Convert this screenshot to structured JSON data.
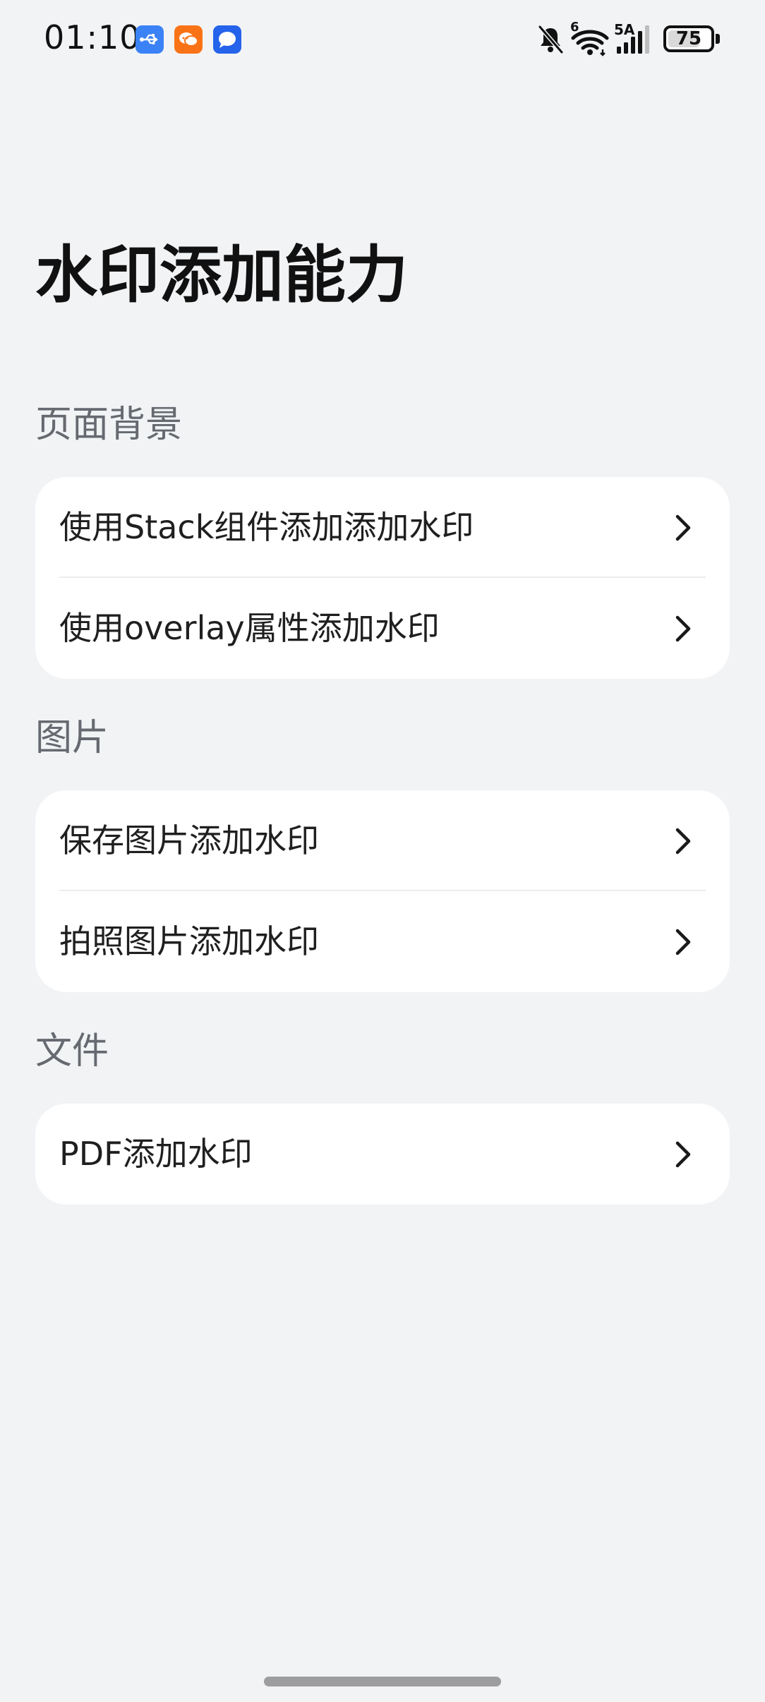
{
  "status_bar": {
    "time": "01:10",
    "notification_icons": [
      "usb-icon",
      "chat-bubble-icon",
      "message-icon"
    ],
    "notification_colors": [
      "#3b82f6",
      "#f97316",
      "#2563eb"
    ],
    "right_icons": [
      "bell-muted-icon",
      "wifi-icon",
      "signal-icon"
    ],
    "wifi_badge": "6",
    "signal_label": "5A",
    "battery_level": "75",
    "battery_percent": 75
  },
  "page": {
    "title": "水印添加能力"
  },
  "sections": [
    {
      "title": "页面背景",
      "items": [
        {
          "label": "使用Stack组件添加添加水印"
        },
        {
          "label": "使用overlay属性添加水印"
        }
      ]
    },
    {
      "title": "图片",
      "items": [
        {
          "label": "保存图片添加水印"
        },
        {
          "label": "拍照图片添加水印"
        }
      ]
    },
    {
      "title": "文件",
      "items": [
        {
          "label": "PDF添加水印"
        }
      ]
    }
  ],
  "colors": {
    "background": "#f1f3f5",
    "card": "#ffffff",
    "section_title": "#666a70",
    "chevron": "#1a1a1a"
  }
}
